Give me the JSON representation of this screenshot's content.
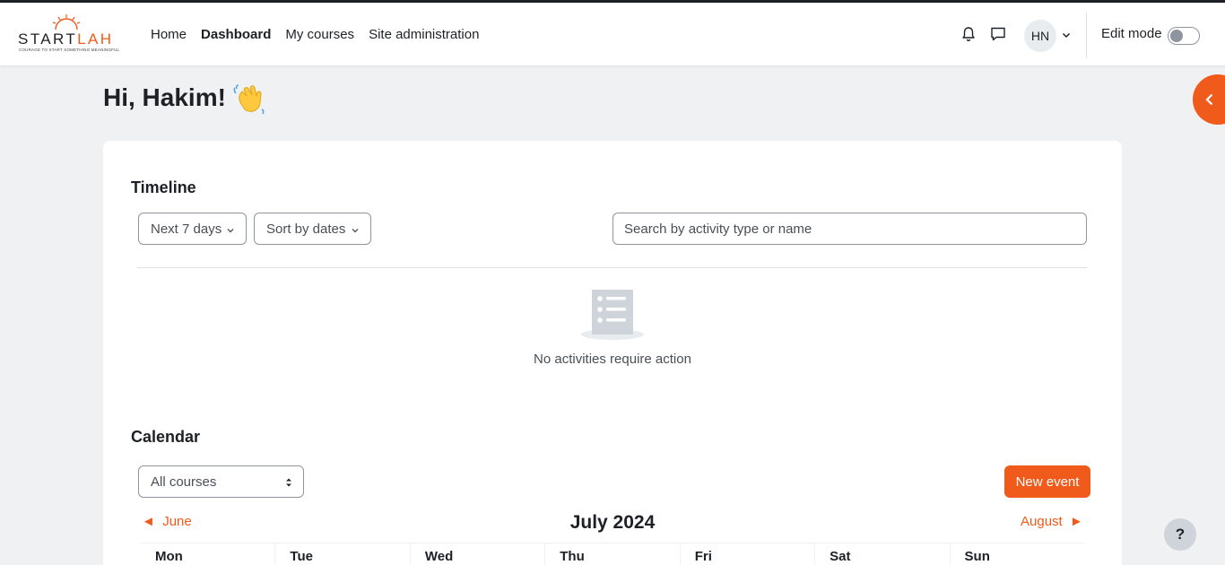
{
  "brand": {
    "name_part1": "START",
    "name_part2": "LAH",
    "tagline": "COURAGE TO START SOMETHING MEANINGFUL"
  },
  "nav": {
    "links": [
      {
        "label": "Home",
        "active": false
      },
      {
        "label": "Dashboard",
        "active": true
      },
      {
        "label": "My courses",
        "active": false
      },
      {
        "label": "Site administration",
        "active": false
      }
    ],
    "user_initials": "HN",
    "edit_mode_label": "Edit mode",
    "edit_mode_on": false
  },
  "page": {
    "greeting": "Hi, Hakim!"
  },
  "timeline": {
    "title": "Timeline",
    "filter_label": "Next 7 days",
    "sort_label": "Sort by dates",
    "search_placeholder": "Search by activity type or name",
    "empty_message": "No activities require action"
  },
  "calendar": {
    "title": "Calendar",
    "course_filter": "All courses",
    "new_event_label": "New event",
    "prev_month": "June",
    "current_month": "July 2024",
    "next_month": "August",
    "weekdays": [
      "Mon",
      "Tue",
      "Wed",
      "Thu",
      "Fri",
      "Sat",
      "Sun"
    ]
  },
  "help": {
    "label": "?"
  },
  "colors": {
    "accent": "#f05a1a",
    "text": "#1d2125",
    "muted": "#4a4f55",
    "background": "#f0f1f3"
  }
}
